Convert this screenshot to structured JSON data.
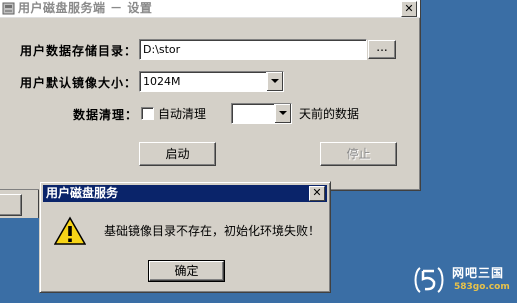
{
  "main_window": {
    "title": "用户磁盘服务端 － 设置",
    "close_glyph": "✕",
    "storage_dir_label": "用户数据存储目录：",
    "storage_dir_value": "D:\\stor",
    "browse_button": "...",
    "image_size_label": "用户默认镜像大小：",
    "image_size_value": "1024M",
    "cleanup_label": "数据清理：",
    "auto_clean_label": "自动清理",
    "days_value": "",
    "days_suffix": "天前的数据",
    "start_button": "启动",
    "stop_button": "停止"
  },
  "dialog": {
    "title": "用户磁盘服务",
    "close_glyph": "✕",
    "message": "基础镜像目录不存在，初始化环境失败！",
    "ok_button": "确定"
  },
  "watermark": {
    "name": "网吧三国",
    "site": "583go.com"
  },
  "colors": {
    "desktop": "#3a6ea5",
    "dialog_title": "#0a246a",
    "face": "#d4d0c8"
  }
}
